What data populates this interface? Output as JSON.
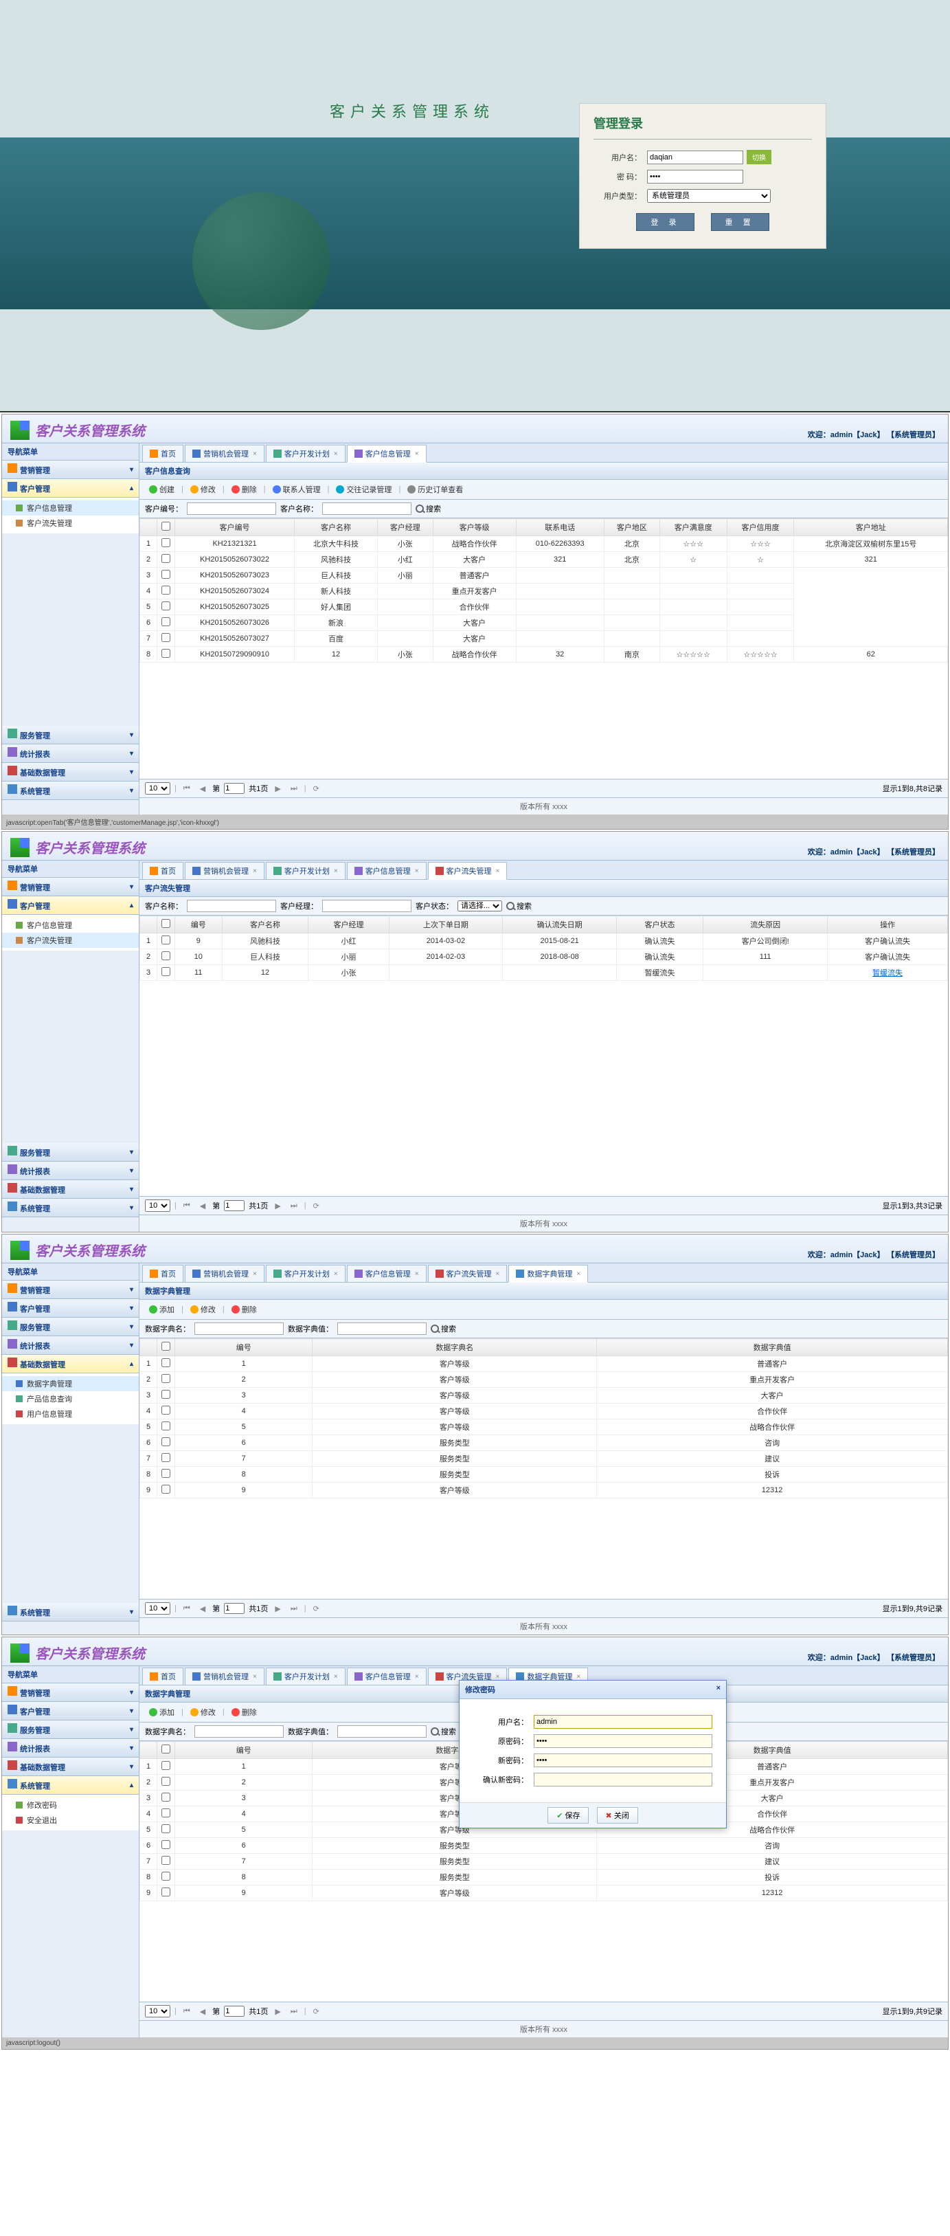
{
  "login": {
    "system_title": "客户关系管理系统",
    "box_title": "管理登录",
    "user_label": "用户名：",
    "user_value": "daqian",
    "switch": "切换",
    "pwd_label": "密   码：",
    "pwd_value": "••••",
    "type_label": "用户类型：",
    "type_value": "系统管理员",
    "login_btn": "登   录",
    "reset_btn": "重   置"
  },
  "common": {
    "app_title": "客户关系管理系统",
    "welcome_prefix": "欢迎：",
    "user": "admin【Jack】",
    "role": "【系统管理员】",
    "nav_title": "导航菜单",
    "copyright": "版本所有 xxxx",
    "page_size": "10",
    "page_label_1": "第",
    "page_num": "1",
    "page_label_2": "共1页"
  },
  "nav_groups": {
    "yingxiao": "营销管理",
    "kehu": "客户管理",
    "fuwu": "服务管理",
    "tongji": "统计报表",
    "jichu": "基础数据管理",
    "xitong": "系统管理"
  },
  "submenu": {
    "kehu_info": "客户信息管理",
    "kehu_loss": "客户流失管理",
    "dict_mgmt": "数据字典管理",
    "prod_query": "产品信息查询",
    "user_mgmt": "用户信息管理",
    "change_pwd": "修改密码",
    "safe_exit": "安全退出"
  },
  "tabs": {
    "home": "首页",
    "yx_chance": "营销机会管理",
    "kh_dev": "客户开发计划",
    "kh_info": "客户信息管理",
    "kh_loss": "客户流失管理",
    "dict": "数据字典管理"
  },
  "view1": {
    "panel_title": "客户信息查询",
    "tb": {
      "create": "创建",
      "edit": "修改",
      "del": "删除",
      "contact": "联系人管理",
      "record": "交往记录管理",
      "history": "历史订单查看"
    },
    "search": {
      "no_label": "客户编号：",
      "name_label": "客户名称：",
      "btn": "搜索"
    },
    "cols": [
      "客户编号",
      "客户名称",
      "客户经理",
      "客户等级",
      "联系电话",
      "客户地区",
      "客户满意度",
      "客户信用度",
      "客户地址"
    ],
    "rows": [
      [
        "1",
        "KH21321321",
        "北京大牛科技",
        "小张",
        "战略合作伙伴",
        "010-62263393",
        "北京",
        "☆☆☆",
        "☆☆☆",
        "北京海淀区双榆树东里15号"
      ],
      [
        "2",
        "KH20150526073022",
        "风驰科技",
        "小红",
        "大客户",
        "321",
        "北京",
        "☆",
        "☆",
        "321"
      ],
      [
        "3",
        "KH20150526073023",
        "巨人科技",
        "小丽",
        "普通客户",
        "",
        "",
        "",
        ""
      ],
      [
        "4",
        "KH20150526073024",
        "新人科技",
        "",
        "重点开发客户",
        "",
        "",
        "",
        ""
      ],
      [
        "5",
        "KH20150526073025",
        "好人集团",
        "",
        "合作伙伴",
        "",
        "",
        "",
        ""
      ],
      [
        "6",
        "KH20150526073026",
        "新浪",
        "",
        "大客户",
        "",
        "",
        "",
        ""
      ],
      [
        "7",
        "KH20150526073027",
        "百度",
        "",
        "大客户",
        "",
        "",
        "",
        ""
      ],
      [
        "8",
        "KH20150729090910",
        "12",
        "小张",
        "战略合作伙伴",
        "32",
        "南京",
        "☆☆☆☆☆",
        "☆☆☆☆☆",
        "62"
      ]
    ],
    "pager_info": "显示1到8,共8记录"
  },
  "view2": {
    "panel_title": "客户流失管理",
    "search": {
      "name_label": "客户名称：",
      "mgr_label": "客户经理：",
      "state_label": "客户状态：",
      "state_value": "请选择...",
      "btn": "搜索"
    },
    "cols": [
      "编号",
      "客户名称",
      "客户经理",
      "上次下单日期",
      "确认流失日期",
      "客户状态",
      "流失原因",
      "操作"
    ],
    "rows": [
      [
        "1",
        "9",
        "风驰科技",
        "小红",
        "2014-03-02",
        "2015-08-21",
        "确认流失",
        "客户公司倒闭!",
        "客户确认流失"
      ],
      [
        "2",
        "10",
        "巨人科技",
        "小丽",
        "2014-02-03",
        "2018-08-08",
        "确认流失",
        "111",
        "客户确认流失"
      ],
      [
        "3",
        "11",
        "12",
        "小张",
        "",
        "",
        "暂缓流失",
        "",
        "暂缓流失"
      ]
    ],
    "link_row": 2,
    "pager_info": "显示1到3,共3记录"
  },
  "view3": {
    "panel_title": "数据字典管理",
    "tb": {
      "add": "添加",
      "edit": "修改",
      "del": "删除"
    },
    "search": {
      "name_label": "数据字典名：",
      "val_label": "数据字典值：",
      "btn": "搜索"
    },
    "cols": [
      "编号",
      "数据字典名",
      "数据字典值"
    ],
    "rows": [
      [
        "1",
        "1",
        "客户等级",
        "普通客户"
      ],
      [
        "2",
        "2",
        "客户等级",
        "重点开发客户"
      ],
      [
        "3",
        "3",
        "客户等级",
        "大客户"
      ],
      [
        "4",
        "4",
        "客户等级",
        "合作伙伴"
      ],
      [
        "5",
        "5",
        "客户等级",
        "战略合作伙伴"
      ],
      [
        "6",
        "6",
        "服务类型",
        "咨询"
      ],
      [
        "7",
        "7",
        "服务类型",
        "建议"
      ],
      [
        "8",
        "8",
        "服务类型",
        "投诉"
      ],
      [
        "9",
        "9",
        "客户等级",
        "12312"
      ]
    ],
    "pager_info": "显示1到9,共9记录",
    "status": "javascript:openTab('客户信息管理','customerManage.jsp','icon-khxxgl')"
  },
  "view4": {
    "dialog": {
      "title": "修改密码",
      "user_label": "用户名：",
      "user_value": "admin",
      "old_label": "原密码：",
      "old_value": "••••",
      "new_label": "新密码：",
      "new_value": "••••",
      "confirm_label": "确认新密码：",
      "save": "保存",
      "close": "关闭"
    },
    "status": "javascript:logout()"
  }
}
